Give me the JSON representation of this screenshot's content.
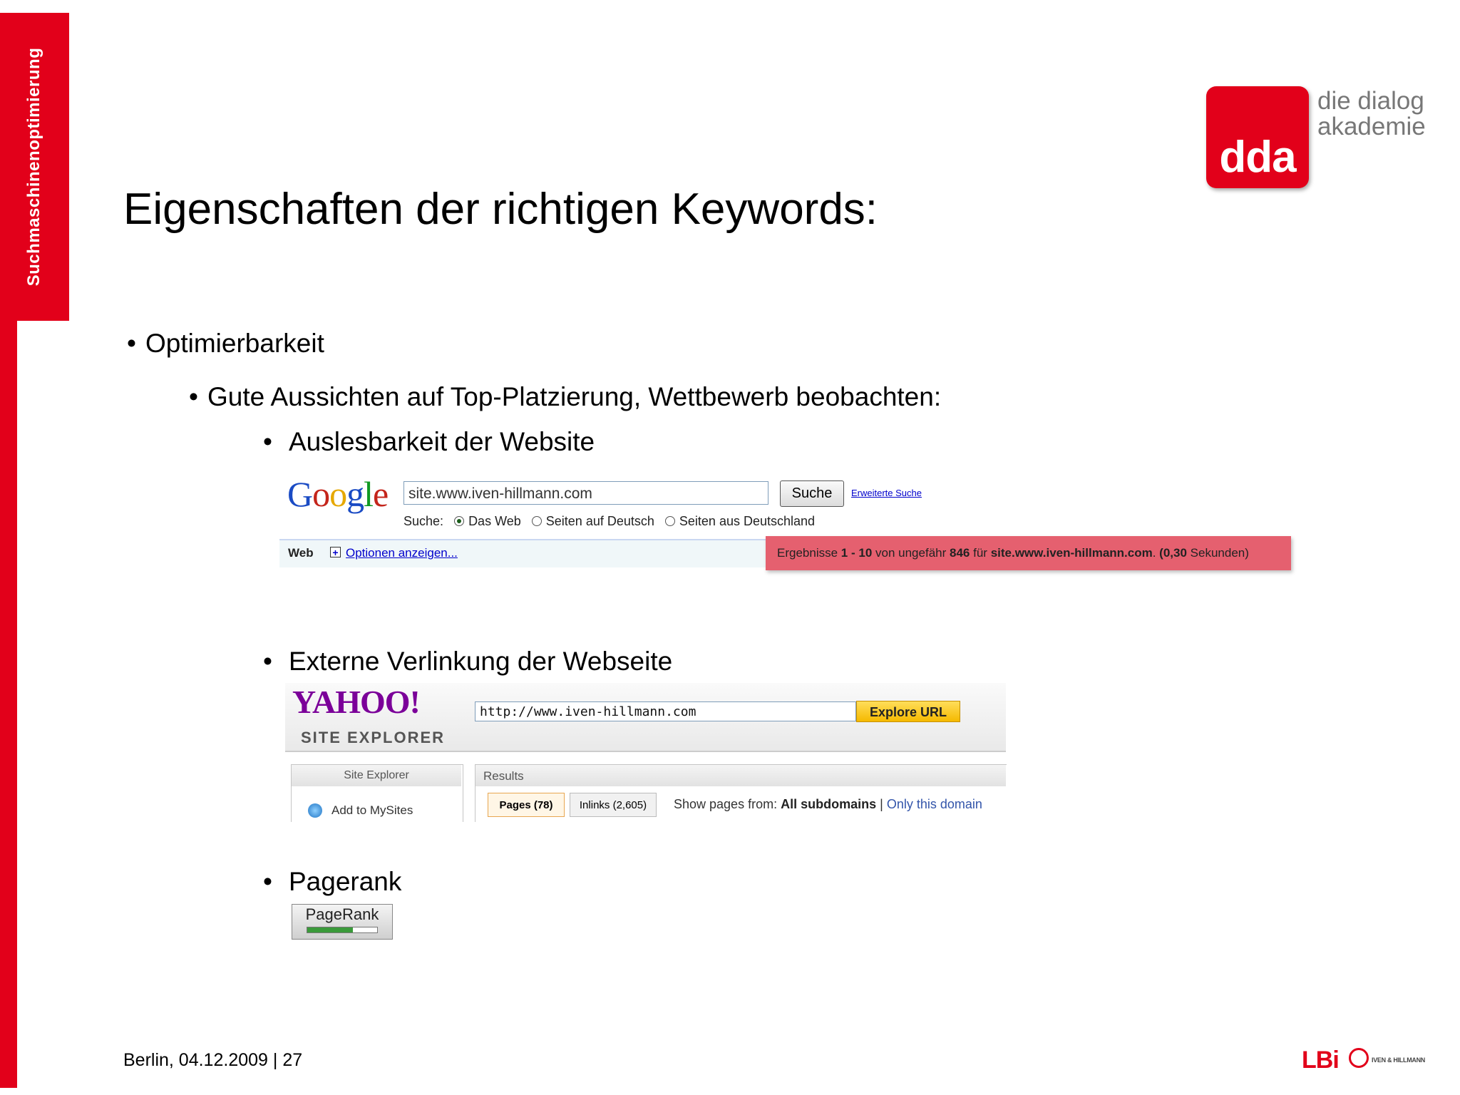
{
  "sidebar": {
    "label": "Suchmaschinenoptimierung"
  },
  "logo": {
    "abbr": "dda",
    "line1": "die dialog",
    "line2": "akademie"
  },
  "title": "Eigenschaften der richtigen Keywords:",
  "bullets": {
    "level1": "Optimierbarkeit",
    "level2": "Gute Aussichten auf Top-Platzierung, Wettbewerb beobachten:",
    "item1": "Auslesbarkeit der Website",
    "item2": "Externe Verlinkung der Webseite",
    "item3": "Pagerank"
  },
  "google": {
    "logo_text": "Google",
    "query": "site.www.iven-hillmann.com",
    "search_button": "Suche",
    "advanced_link": "Erweiterte Suche",
    "search_label": "Suche:",
    "radio_options": [
      "Das Web",
      "Seiten auf Deutsch",
      "Seiten aus Deutschland"
    ],
    "selected_option": "Das Web",
    "tab_web": "Web",
    "options_link": "Optionen anzeigen...",
    "results": {
      "prefix": "Ergebnisse",
      "range": "1 - 10",
      "von": "von ungefähr",
      "count": "846",
      "fuer": "für",
      "site": "site.www.iven-hillmann.com",
      "time": "(0,30",
      "unit": "Sekunden)"
    }
  },
  "yahoo": {
    "logo_text": "YAHOO!",
    "subtitle": "SITE EXPLORER",
    "url": "http://www.iven-hillmann.com",
    "explore_button": "Explore URL",
    "left_header": "Site Explorer",
    "add_link": "Add to MySites",
    "results_header": "Results",
    "tab_pages": "Pages (78)",
    "tab_inlinks": "Inlinks (2,605)",
    "show_label": "Show pages from:",
    "all_subdomains": "All subdomains",
    "separator": "|",
    "only_domain": "Only this domain"
  },
  "pagerank": {
    "label": "PageRank",
    "level": 0.65,
    "fill_color": "#3a9a3a"
  },
  "footer": "Berlin, 04.12.2009 | 27",
  "brand": {
    "lbi": "LBi",
    "partner": "IVEN & HILLMANN",
    "accent": "#e2001a"
  }
}
